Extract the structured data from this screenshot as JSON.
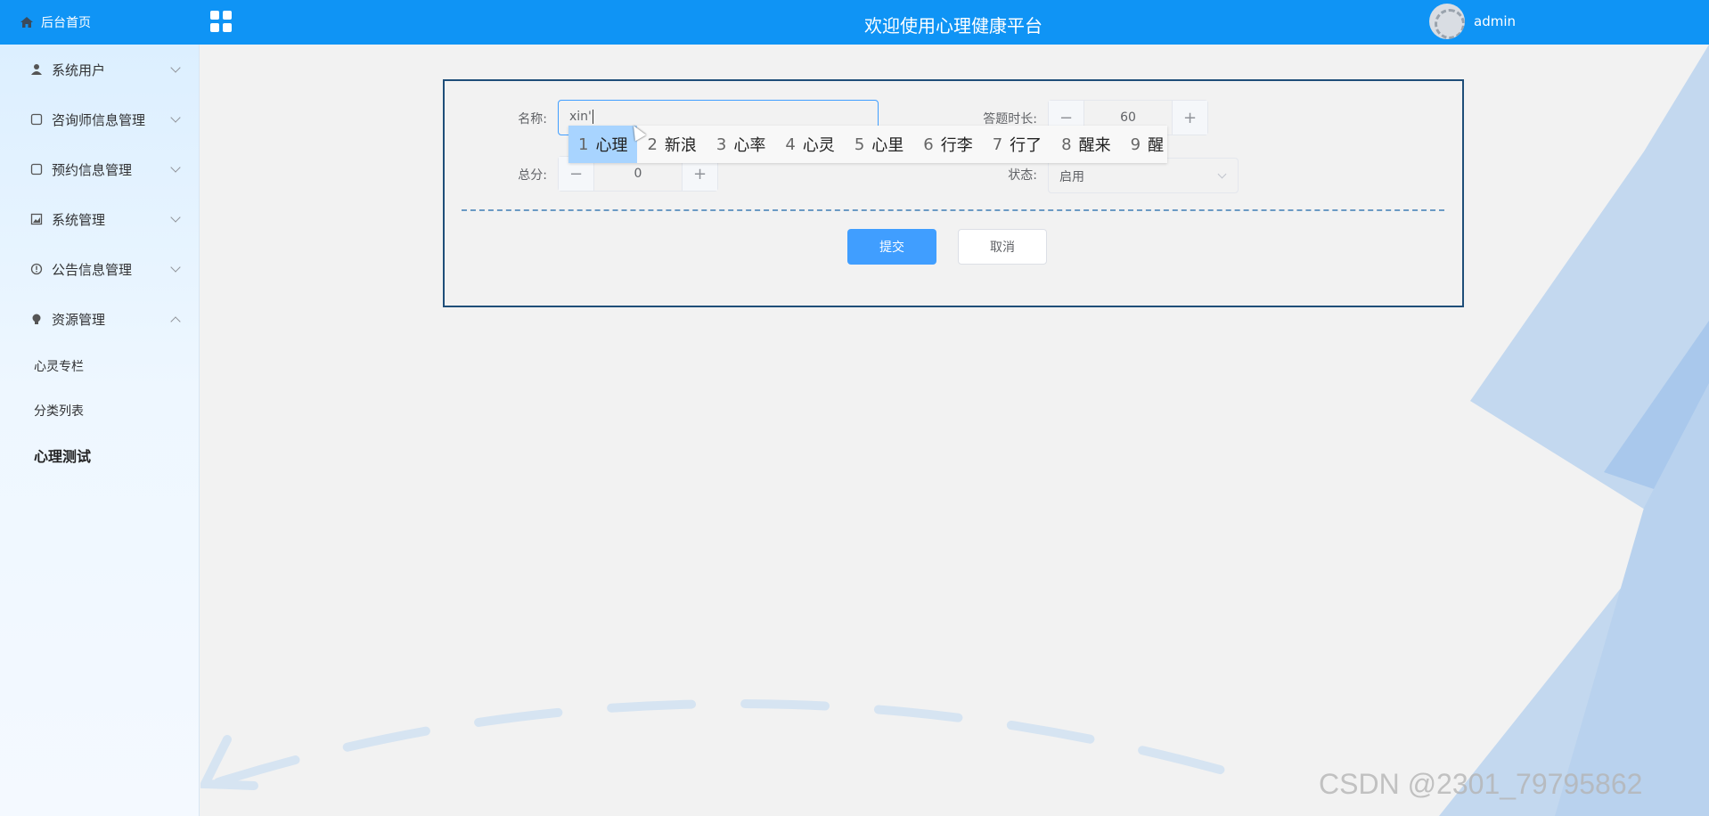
{
  "header": {
    "home_label": "后台首页",
    "title": "欢迎使用心理健康平台",
    "username": "admin"
  },
  "sidebar": {
    "items": [
      {
        "label": "系统用户",
        "icon": "user-icon"
      },
      {
        "label": "咨询师信息管理",
        "icon": "doc-icon"
      },
      {
        "label": "预约信息管理",
        "icon": "doc-icon"
      },
      {
        "label": "系统管理",
        "icon": "image-icon"
      },
      {
        "label": "公告信息管理",
        "icon": "info-icon"
      },
      {
        "label": "资源管理",
        "icon": "bulb-icon"
      }
    ],
    "sub_items": [
      "心灵专栏",
      "分类列表",
      "心理测试"
    ]
  },
  "form": {
    "name_label": "名称:",
    "name_value": "xin'",
    "duration_label": "答题时长:",
    "duration_value": "60",
    "score_label": "总分:",
    "score_value": "0",
    "status_label": "状态:",
    "status_value": "启用",
    "submit_label": "提交",
    "cancel_label": "取消"
  },
  "ime": {
    "candidates": [
      {
        "n": "1",
        "text": "心理"
      },
      {
        "n": "2",
        "text": "新浪"
      },
      {
        "n": "3",
        "text": "心率"
      },
      {
        "n": "4",
        "text": "心灵"
      },
      {
        "n": "5",
        "text": "心里"
      },
      {
        "n": "6",
        "text": "行李"
      },
      {
        "n": "7",
        "text": "行了"
      },
      {
        "n": "8",
        "text": "醒来"
      },
      {
        "n": "9",
        "text": "醒"
      }
    ]
  },
  "watermark": "CSDN @2301_79795862",
  "colors": {
    "accent": "#409eff",
    "header": "#0f94f5",
    "card_border": "#1f4e79"
  }
}
